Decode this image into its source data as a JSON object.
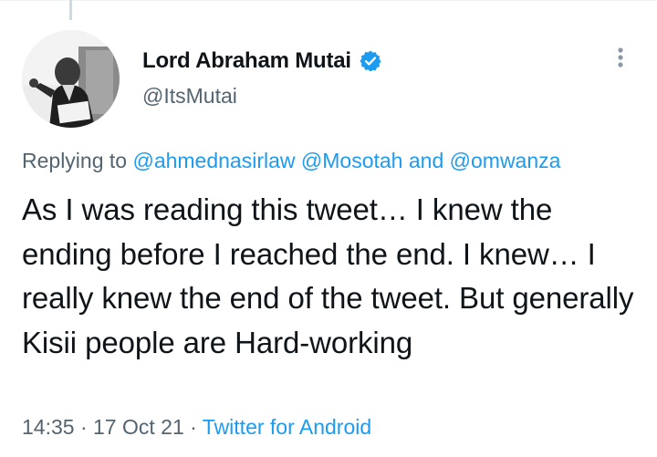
{
  "tweet": {
    "author": {
      "display_name": "Lord Abraham Mutai",
      "handle": "@ItsMutai",
      "verified": true,
      "avatar_icon": "profile-photo"
    },
    "replying": {
      "prefix": "Replying to",
      "mention_1": "@ahmednasirlaw",
      "mention_2": "@Mosotah",
      "conjunction": "and",
      "mention_3": "@omwanza"
    },
    "text": "As I was reading this tweet… I knew the ending before I reached the end. I knew… I really knew the end of the tweet. But generally Kisii people are Hard-working",
    "time": "14:35",
    "separator": "·",
    "date": "17 Oct 21",
    "source": "Twitter for Android"
  },
  "colors": {
    "text_primary": "#0f1419",
    "text_secondary": "#536471",
    "link": "#1d9bf0",
    "verified_badge": "#1d9bf0"
  },
  "icons": {
    "more": "more-vertical-icon",
    "verified": "verified-badge-icon"
  }
}
